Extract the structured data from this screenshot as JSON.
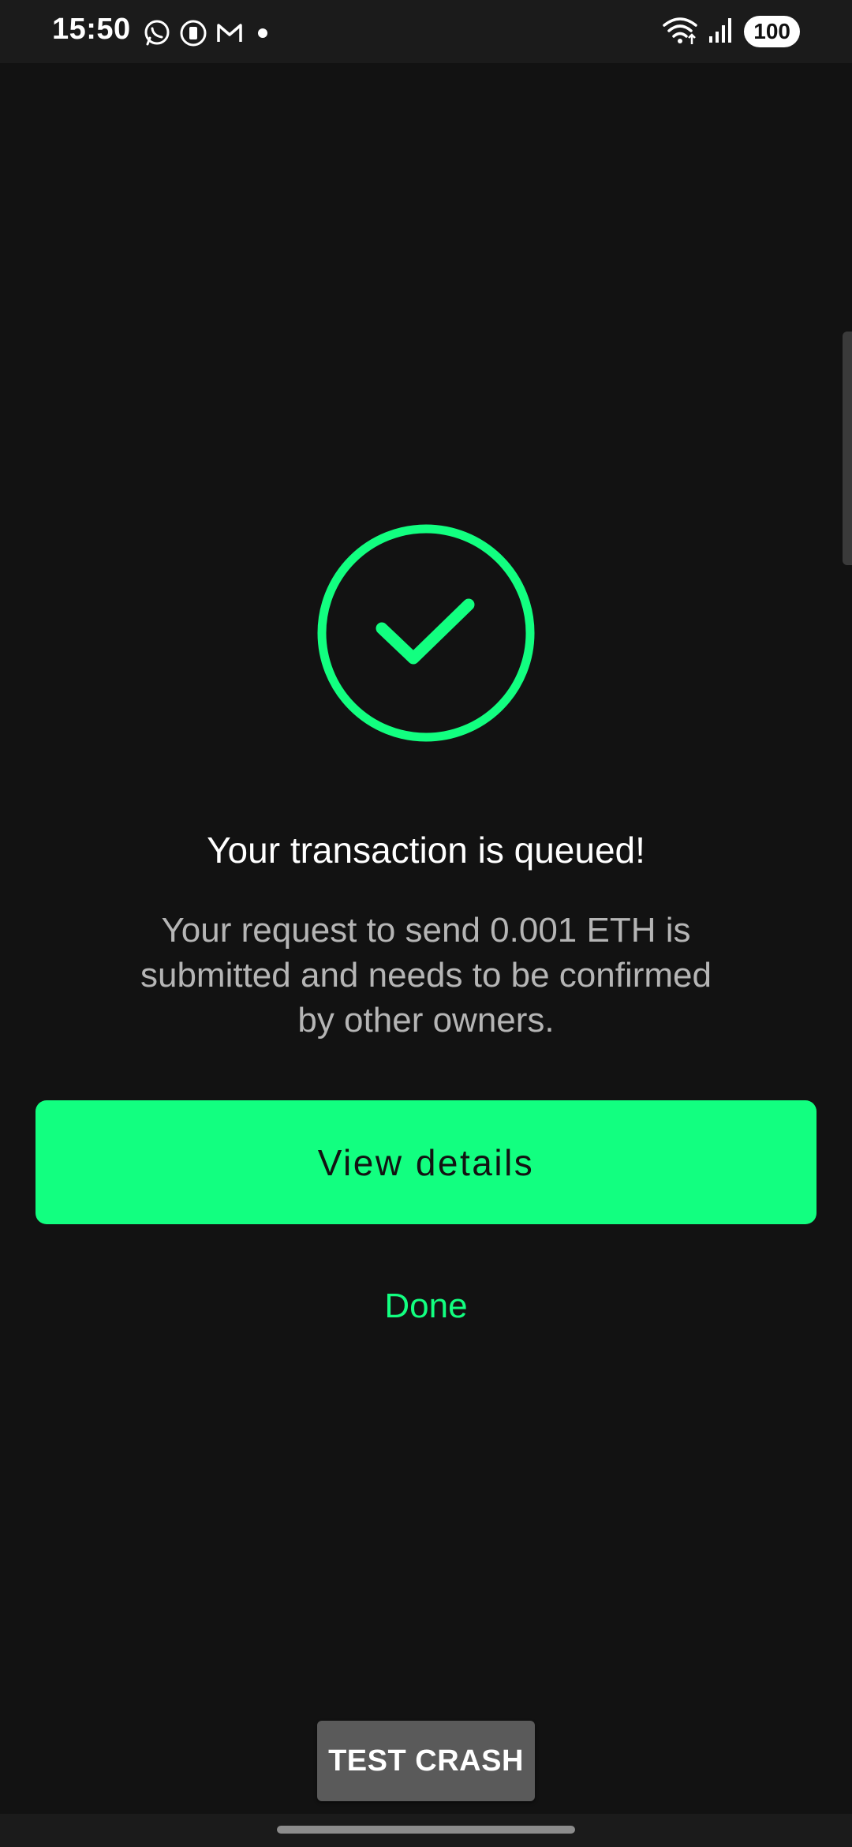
{
  "status_bar": {
    "time": "15:50",
    "notification_icons": [
      "whatsapp-icon",
      "app-notification-icon",
      "gmail-icon",
      "dot-icon"
    ],
    "battery": "100"
  },
  "success": {
    "icon": "check-circle-icon",
    "accent_color": "#12ff80",
    "title": "Your transaction is queued!",
    "message": "Your request to send 0.001 ETH is submitted and needs to be confirmed by other owners."
  },
  "actions": {
    "view_details_label": "View details",
    "done_label": "Done"
  },
  "debug": {
    "test_crash_label": "TEST CRASH"
  },
  "colors": {
    "background": "#121212",
    "accent": "#12ff80",
    "message_text": "#b5b5b5",
    "crash_button": "#5a5a5a"
  }
}
